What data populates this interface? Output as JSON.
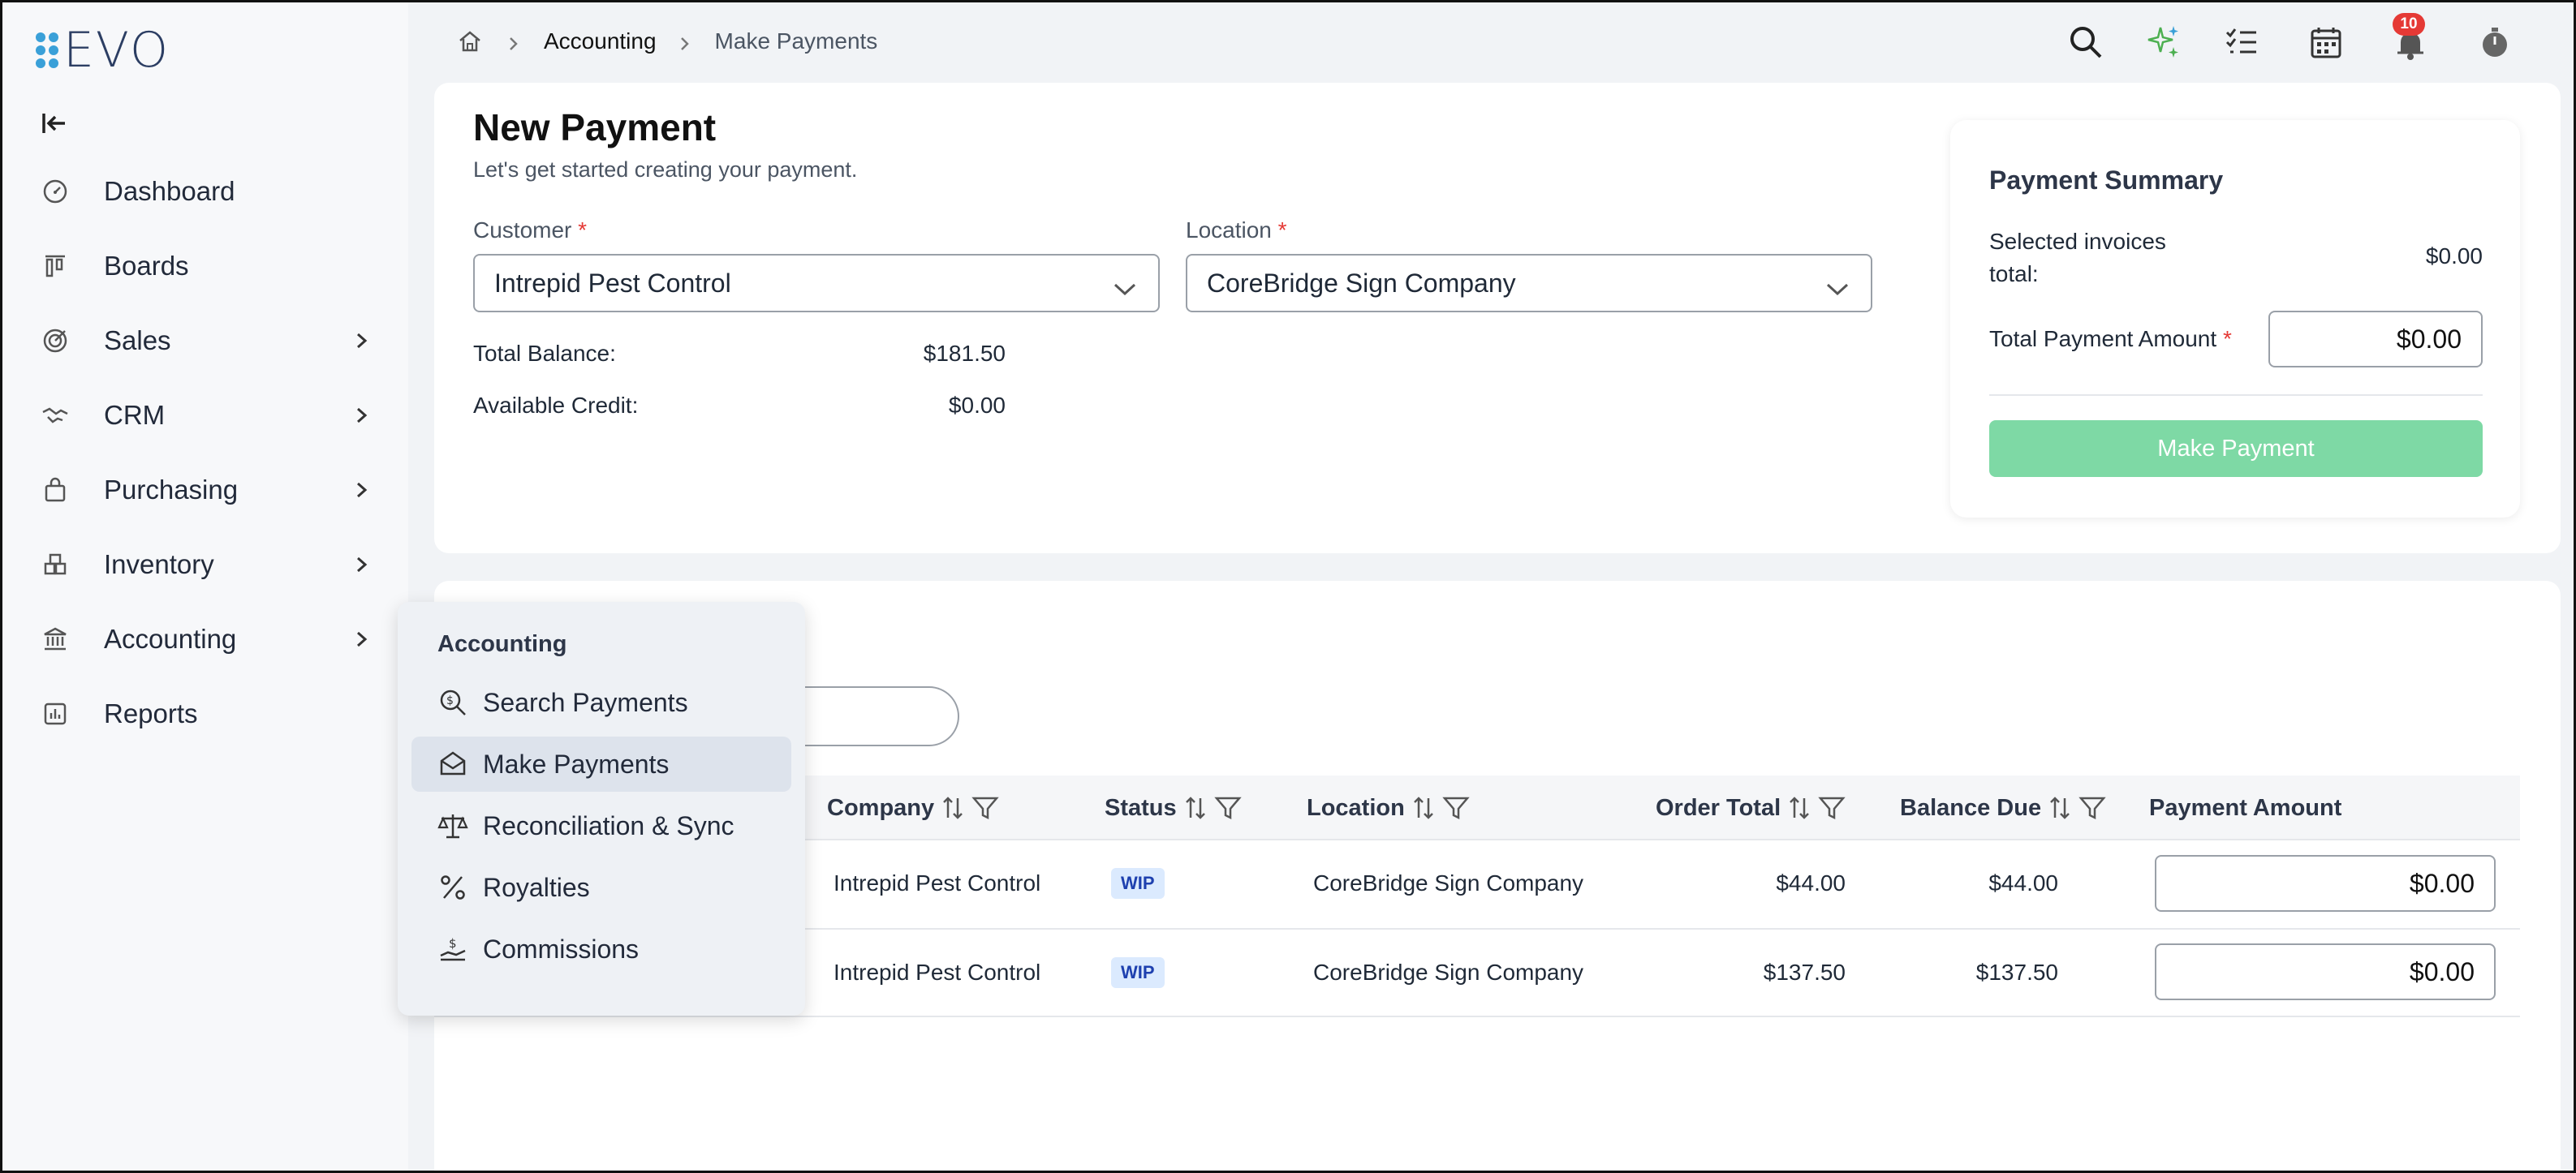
{
  "app": {
    "logo_text": "EVO"
  },
  "sidebar": {
    "items": [
      {
        "label": "Dashboard",
        "icon": "dashboard-icon",
        "has_submenu": false
      },
      {
        "label": "Boards",
        "icon": "boards-icon",
        "has_submenu": false
      },
      {
        "label": "Sales",
        "icon": "sales-icon",
        "has_submenu": true
      },
      {
        "label": "CRM",
        "icon": "handshake-icon",
        "has_submenu": true
      },
      {
        "label": "Purchasing",
        "icon": "shopping-bag-icon",
        "has_submenu": true
      },
      {
        "label": "Inventory",
        "icon": "inventory-icon",
        "has_submenu": true
      },
      {
        "label": "Accounting",
        "icon": "bank-icon",
        "has_submenu": true
      },
      {
        "label": "Reports",
        "icon": "reports-icon",
        "has_submenu": false
      }
    ]
  },
  "breadcrumb": {
    "level1": "Accounting",
    "level2": "Make Payments"
  },
  "notifications": {
    "count": "10"
  },
  "page": {
    "title": "New Payment",
    "subtitle": "Let's get started creating your payment.",
    "customer": {
      "label": "Customer",
      "required": "*",
      "value": "Intrepid Pest Control"
    },
    "location": {
      "label": "Location",
      "required": "*",
      "value": "CoreBridge Sign Company"
    },
    "total_balance": {
      "label": "Total Balance:",
      "value": "$181.50"
    },
    "available_credit": {
      "label": "Available Credit:",
      "value": "$0.00"
    }
  },
  "summary": {
    "title": "Payment Summary",
    "selected_label_1": "Selected invoices",
    "selected_label_2": "total:",
    "selected_value": "$0.00",
    "total_amount_label": "Total Payment Amount",
    "required": "*",
    "total_amount_value": "$0.00",
    "button": "Make Payment"
  },
  "table": {
    "columns": [
      "Company",
      "Status",
      "Location",
      "Order Total",
      "Balance Due",
      "Payment Amount"
    ],
    "rows": [
      {
        "company": "Intrepid Pest Control",
        "status": "WIP",
        "location": "CoreBridge Sign Company",
        "order_total": "$44.00",
        "balance_due": "$44.00",
        "payment": "$0.00"
      },
      {
        "company": "Intrepid Pest Control",
        "status": "WIP",
        "location": "CoreBridge Sign Company",
        "order_total": "$137.50",
        "balance_due": "$137.50",
        "payment": "$0.00"
      }
    ]
  },
  "flyout": {
    "title": "Accounting",
    "items": [
      {
        "label": "Search Payments",
        "icon": "search-payments-icon",
        "active": false
      },
      {
        "label": "Make Payments",
        "icon": "make-payments-icon",
        "active": true
      },
      {
        "label": "Reconciliation & Sync",
        "icon": "scale-icon",
        "active": false
      },
      {
        "label": "Royalties",
        "icon": "percent-icon",
        "active": false
      },
      {
        "label": "Commissions",
        "icon": "commissions-icon",
        "active": false
      }
    ]
  },
  "colors": {
    "accent": "#3aa0d8",
    "button_disabled": "#7ed9a5",
    "required": "#e53935",
    "badge": "#e53935"
  }
}
